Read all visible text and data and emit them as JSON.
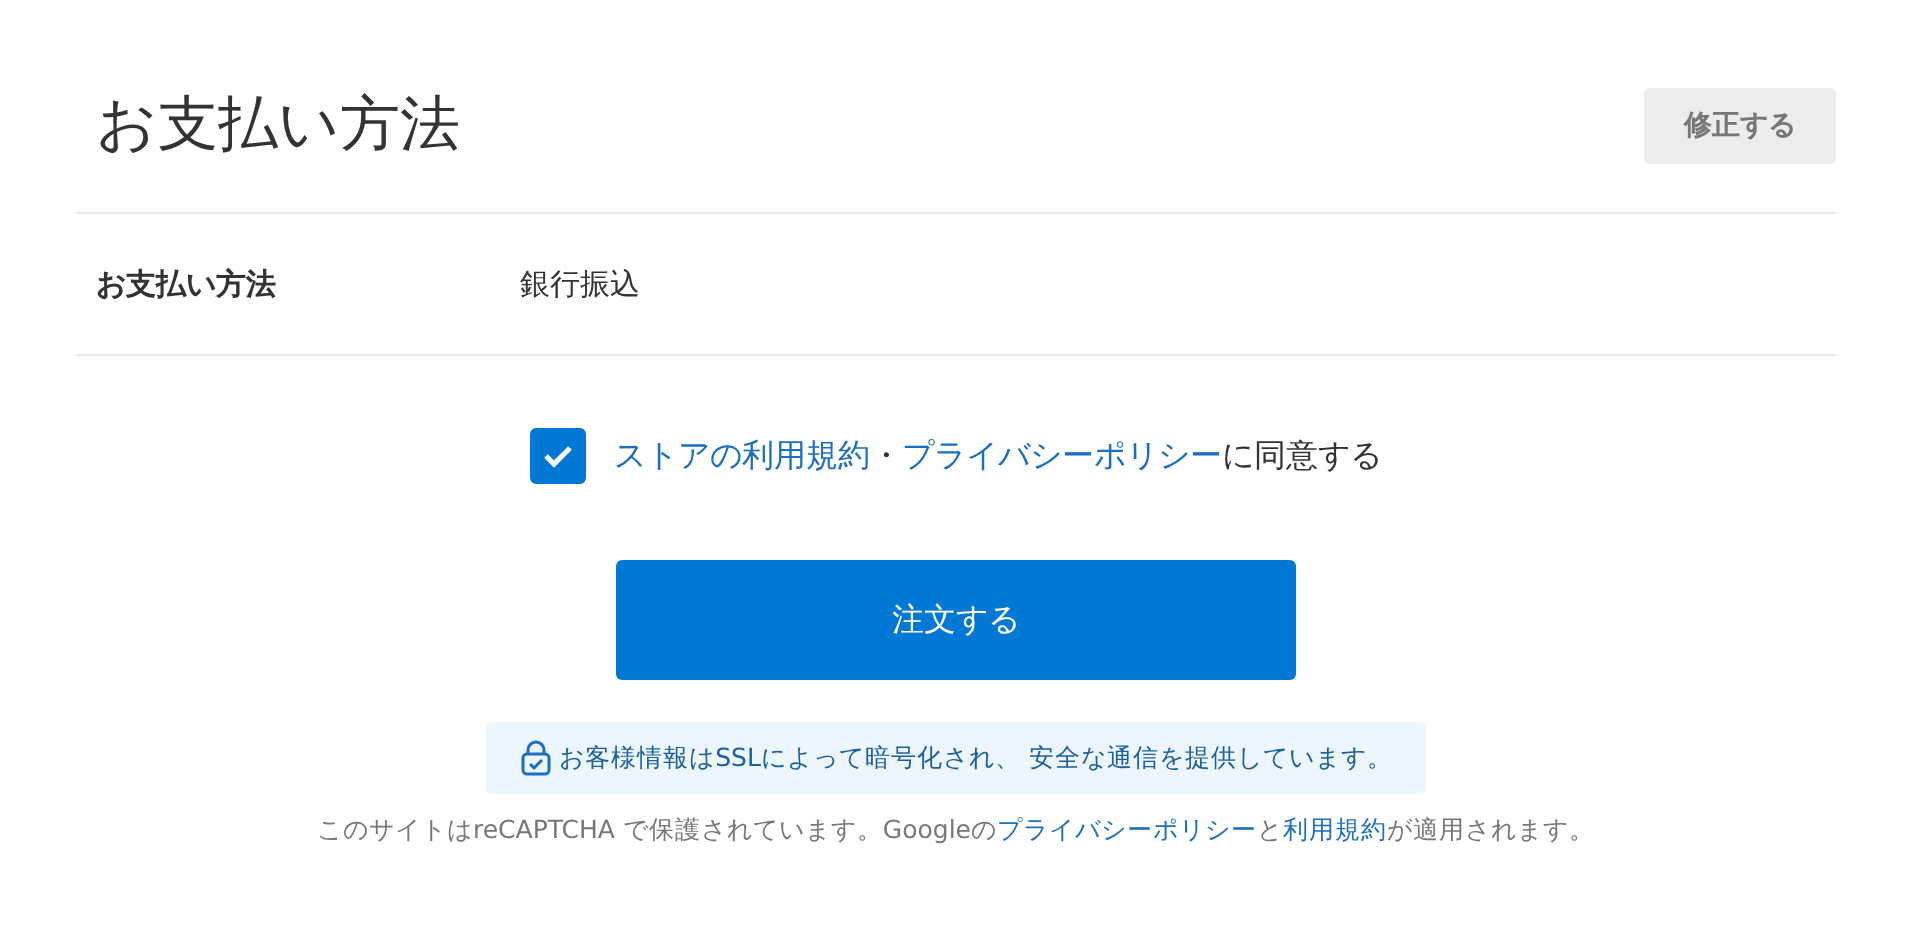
{
  "section": {
    "title": "お支払い方法",
    "edit_button": "修正する"
  },
  "rows": [
    {
      "label": "お支払い方法",
      "value": "銀行振込"
    }
  ],
  "agreement": {
    "checked": true,
    "parts": [
      {
        "kind": "link",
        "text": "ストアの利用規約"
      },
      {
        "kind": "text",
        "text": "・"
      },
      {
        "kind": "link",
        "text": "プライバシーポリシー"
      },
      {
        "kind": "text",
        "text": "に同意する"
      }
    ]
  },
  "order_button": "注文する",
  "ssl_notice": "お客様情報はSSLによって暗号化され、 安全な通信を提供しています。",
  "footer": {
    "parts": [
      {
        "kind": "text",
        "text": "このサイトはreCAPTCHA で保護されています。Googleの"
      },
      {
        "kind": "link",
        "text": "プライバシーポリシー"
      },
      {
        "kind": "text",
        "text": "と"
      },
      {
        "kind": "link",
        "text": "利用規約"
      },
      {
        "kind": "text",
        "text": "が適用されます。"
      }
    ]
  }
}
